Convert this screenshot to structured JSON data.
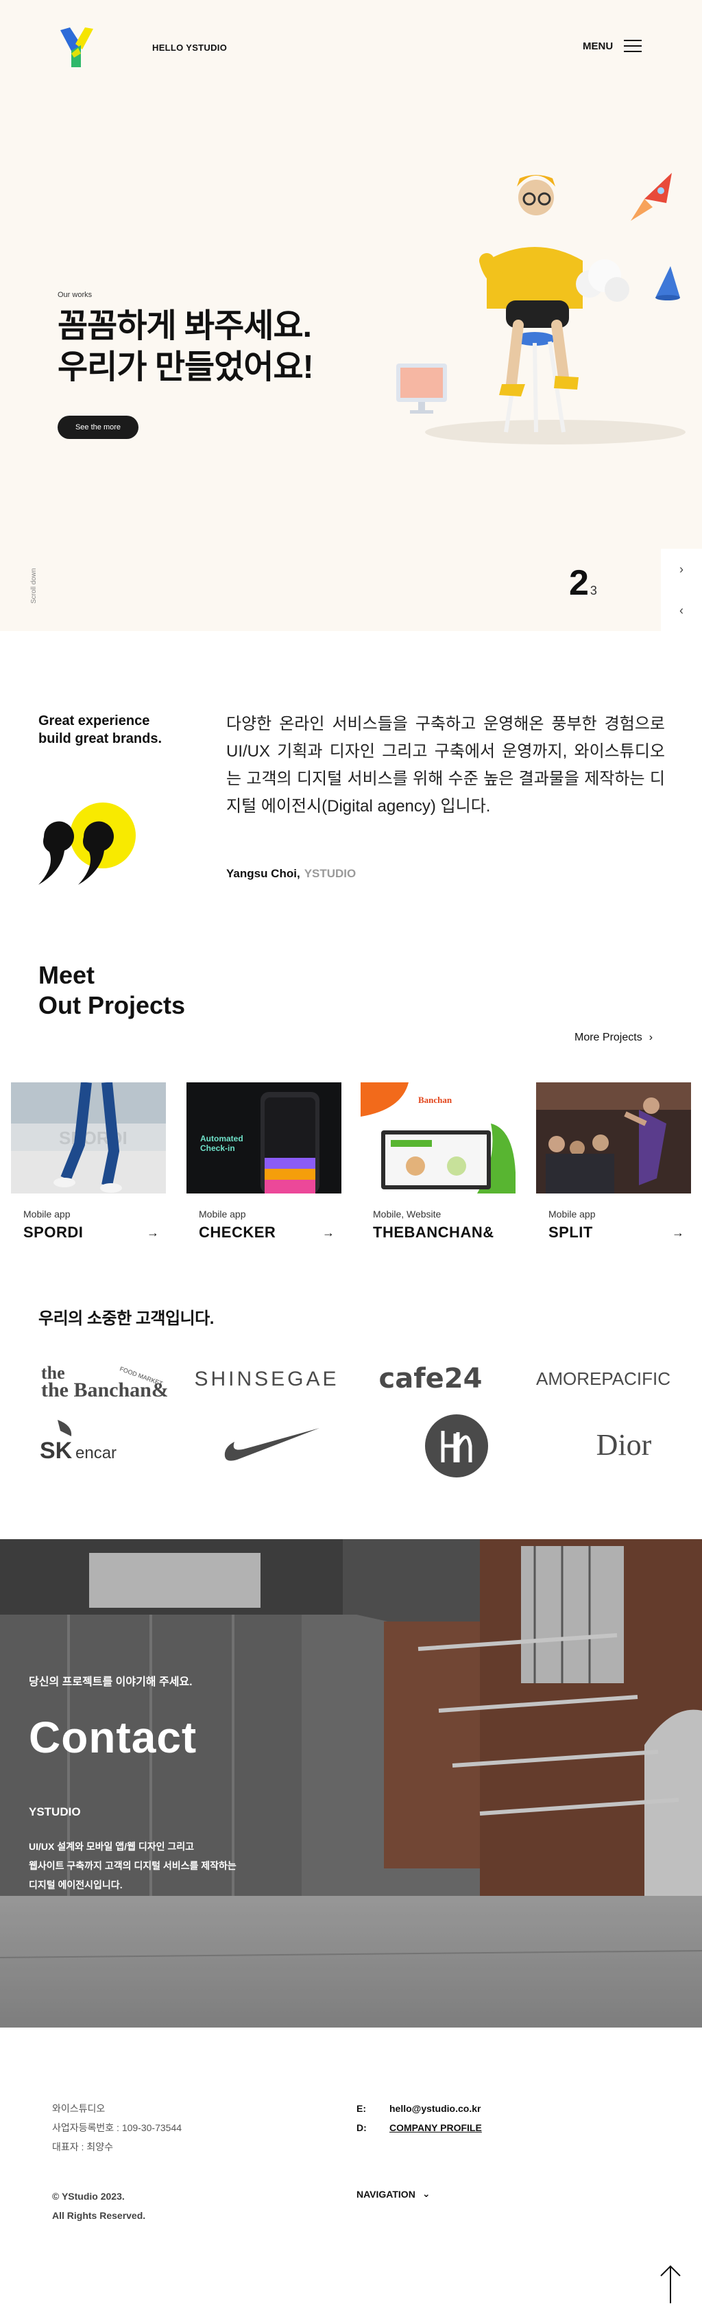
{
  "header": {
    "brand_text": "HELLO YSTUDIO",
    "menu_label": "MENU"
  },
  "hero": {
    "eyebrow": "Our works",
    "title_line1": "꼼꼼하게 봐주세요.",
    "title_line2": "우리가 만들었어요!",
    "cta_label": "See the more",
    "scroll_label": "Scroll down",
    "slide_current": "2",
    "slide_total": "3"
  },
  "about": {
    "heading": "Great experience\nbuild great brands.",
    "body": "다양한 온라인 서비스들을 구축하고 운영해온 풍부한 경험으로 UI/UX 기획과 디자인 그리고 구축에서 운영까지, 와이스튜디오는 고객의 디지털 서비스를 위해 수준 높은 결과물을 제작하는 디지털 에이전시(Digital agency) 입니다.",
    "author": "Yangsu Choi,",
    "company": "YSTUDIO"
  },
  "projects": {
    "title": "Meet\nOut Projects",
    "more_label": "More Projects",
    "items": [
      {
        "category": "Mobile app",
        "name": "SPORDI"
      },
      {
        "category": "Mobile app",
        "name": "CHECKER"
      },
      {
        "category": "Mobile, Website",
        "name": "THEBANCHAN&"
      },
      {
        "category": "Mobile app",
        "name": "SPLIT"
      }
    ]
  },
  "clients": {
    "title": "우리의 소중한 고객입니다.",
    "logos": [
      "the Banchan&",
      "SHINSEGAE",
      "cafe24",
      "AMOREPACIFIC",
      "SK encar",
      "Nike",
      "HM",
      "Dior"
    ]
  },
  "contact": {
    "subtitle": "당신의 프로젝트를 이야기해 주세요.",
    "title": "Contact",
    "brand": "YSTUDIO",
    "desc_line1": "UI/UX 설계와 모바일 앱/웹 디자인 그리고",
    "desc_line2": "웹사이트 구축까지 고객의 디지털 서비스를 제작하는",
    "desc_line3": "디지털 에이전시입니다."
  },
  "footer": {
    "company": "와이스튜디오",
    "biz_no": "사업자등록번호 : 109-30-73544",
    "ceo": "대표자 : 최양수",
    "email_key": "E:",
    "email": "hello@ystudio.co.kr",
    "doc_key": "D:",
    "doc_label": "COMPANY PROFILE",
    "copy_line1": "© YStudio 2023.",
    "copy_line2": "All Rights Reserved.",
    "nav_label": "NAVIGATION"
  },
  "colors": {
    "hero_bg": "#fcf8f2",
    "logo_yellow": "#f5e400",
    "logo_green": "#2fb86b",
    "logo_blue": "#2d6bd8",
    "quote_yellow": "#f8ea00"
  }
}
